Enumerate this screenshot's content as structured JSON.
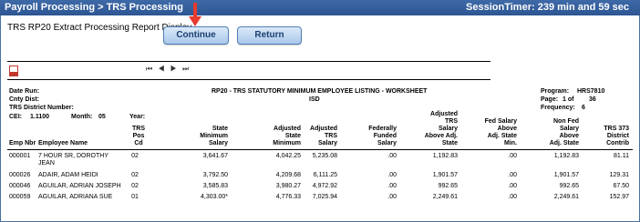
{
  "topbar": {
    "breadcrumb": "Payroll Processing > TRS Processing",
    "session_timer": "SessionTimer: 239 min and 59 sec"
  },
  "page_title": "TRS RP20 Extract Processing Report Display",
  "buttons": {
    "continue": "Continue",
    "return": "Return"
  },
  "viewer": {
    "nav_glyphs": "⏮ ◀ ▶ ⏭"
  },
  "report": {
    "title": "RP20 -  TRS STATUTORY MINIMUM EMPLOYEE LISTING - WORKSHEET",
    "subtitle": "ISD",
    "date_run_label": "Date Run:",
    "cnty_dist_label": "Cnty Dist:",
    "trs_district_label": "TRS District Number:",
    "cei_label": "CEI:",
    "cei_value": "1.1100",
    "month_label": "Month:",
    "month_value": "05",
    "year_label": "Year:",
    "program_label": "Program:",
    "program_value": "HRS7810",
    "page_label": "Page:",
    "page_value": "1 of",
    "page_total": "36",
    "frequency_label": "Frequency:",
    "frequency_value": "6",
    "columns": [
      "Emp Nbr",
      "Employee Name",
      "TRS\nPos\nCd",
      "State\nMinimum\nSalary",
      "Adjusted\nState\nMinimum",
      "Adjusted\nTRS\nSalary",
      "Federally\nFunded\nSalary",
      "Adjusted\nTRS\nSalary\nAbove Adj.\nState",
      "Fed Salary\nAbove\nAdj. State\nMin.",
      "Non Fed\nSalary\nAbove\nAdj. State",
      "TRS 373\nDistrict\nContrib"
    ],
    "rows": [
      {
        "emp_nbr": "000001",
        "name": "7 HOUR SR, DOROTHY",
        "name2": "JEAN",
        "pos": "02",
        "state_min": "3,641.67",
        "adj_state_min": "4,042.25",
        "adj_trs": "5,235.08",
        "fed": ".00",
        "above_state": "1,192.83",
        "fed_above": ".00",
        "nonfed_above": "1,192.83",
        "contrib": "81.11"
      },
      {
        "emp_nbr": "000026",
        "name": "ADAIR, ADAM HEIDI",
        "name2": "",
        "pos": "02",
        "state_min": "3,792.50",
        "adj_state_min": "4,209.68",
        "adj_trs": "6,111.25",
        "fed": ".00",
        "above_state": "1,901.57",
        "fed_above": ".00",
        "nonfed_above": "1,901.57",
        "contrib": "129.31"
      },
      {
        "emp_nbr": "000046",
        "name": "AGUILAR, ADRIAN JOSEPH",
        "name2": "",
        "pos": "02",
        "state_min": "3,585.83",
        "adj_state_min": "3,980.27",
        "adj_trs": "4,972.92",
        "fed": ".00",
        "above_state": "992.65",
        "fed_above": ".00",
        "nonfed_above": "992.65",
        "contrib": "67.50"
      },
      {
        "emp_nbr": "000059",
        "name": "AGUILAR, ADRIANA SUE",
        "name2": "",
        "pos": "01",
        "state_min": "4,303.00*",
        "adj_state_min": "4,776.33",
        "adj_trs": "7,025.94",
        "fed": ".00",
        "above_state": "2,249.61",
        "fed_above": ".00",
        "nonfed_above": "2,249.61",
        "contrib": "152.97"
      }
    ]
  },
  "colors": {
    "topbar": "#2c5592",
    "button_bg": "#a9c8ea",
    "arrow": "#e63b2e"
  }
}
